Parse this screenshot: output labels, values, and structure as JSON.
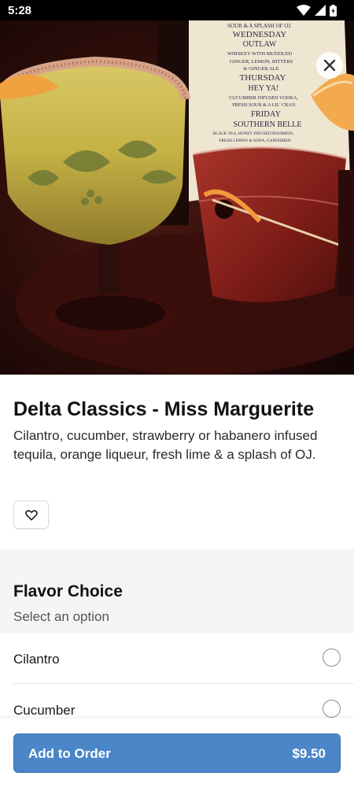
{
  "status_bar": {
    "time": "5:28"
  },
  "hero": {
    "menu_card_lines": [
      "SOUR & A SPLASH OF OJ.",
      "WEDNESDAY",
      "OUTLAW",
      "WHISKEY WITH MUDDLED",
      "GINGER, LEMON, BITTERS",
      "& GINGER ALE",
      "THURSDAY",
      "HEY YA!",
      "CUCUMBER INFUSED VODKA,",
      "FRESH SOUR & A LIL' CRAN.",
      "FRIDAY",
      "SOUTHERN BELLE",
      "BLACK TEA, HONEY INFUSED BOURBON,",
      "FRESH LEMON & SODA, GARNISHED"
    ]
  },
  "item": {
    "title": "Delta Classics - Miss Marguerite",
    "description": "Cilantro, cucumber, strawberry or habanero infused tequila, orange liqueur, fresh lime & a splash of OJ."
  },
  "options": {
    "title": "Flavor Choice",
    "subtitle": "Select an option",
    "choices": [
      {
        "label": "Cilantro",
        "selected": false
      },
      {
        "label": "Cucumber",
        "selected": false
      }
    ]
  },
  "order": {
    "button_label": "Add to Order",
    "price": "$9.50"
  },
  "colors": {
    "accent": "#4a86c8",
    "background_section": "#f5f5f7"
  },
  "icons": {
    "close": "close-icon",
    "favorite": "heart-icon",
    "wifi": "wifi-icon",
    "signal": "signal-icon",
    "battery": "battery-icon"
  }
}
